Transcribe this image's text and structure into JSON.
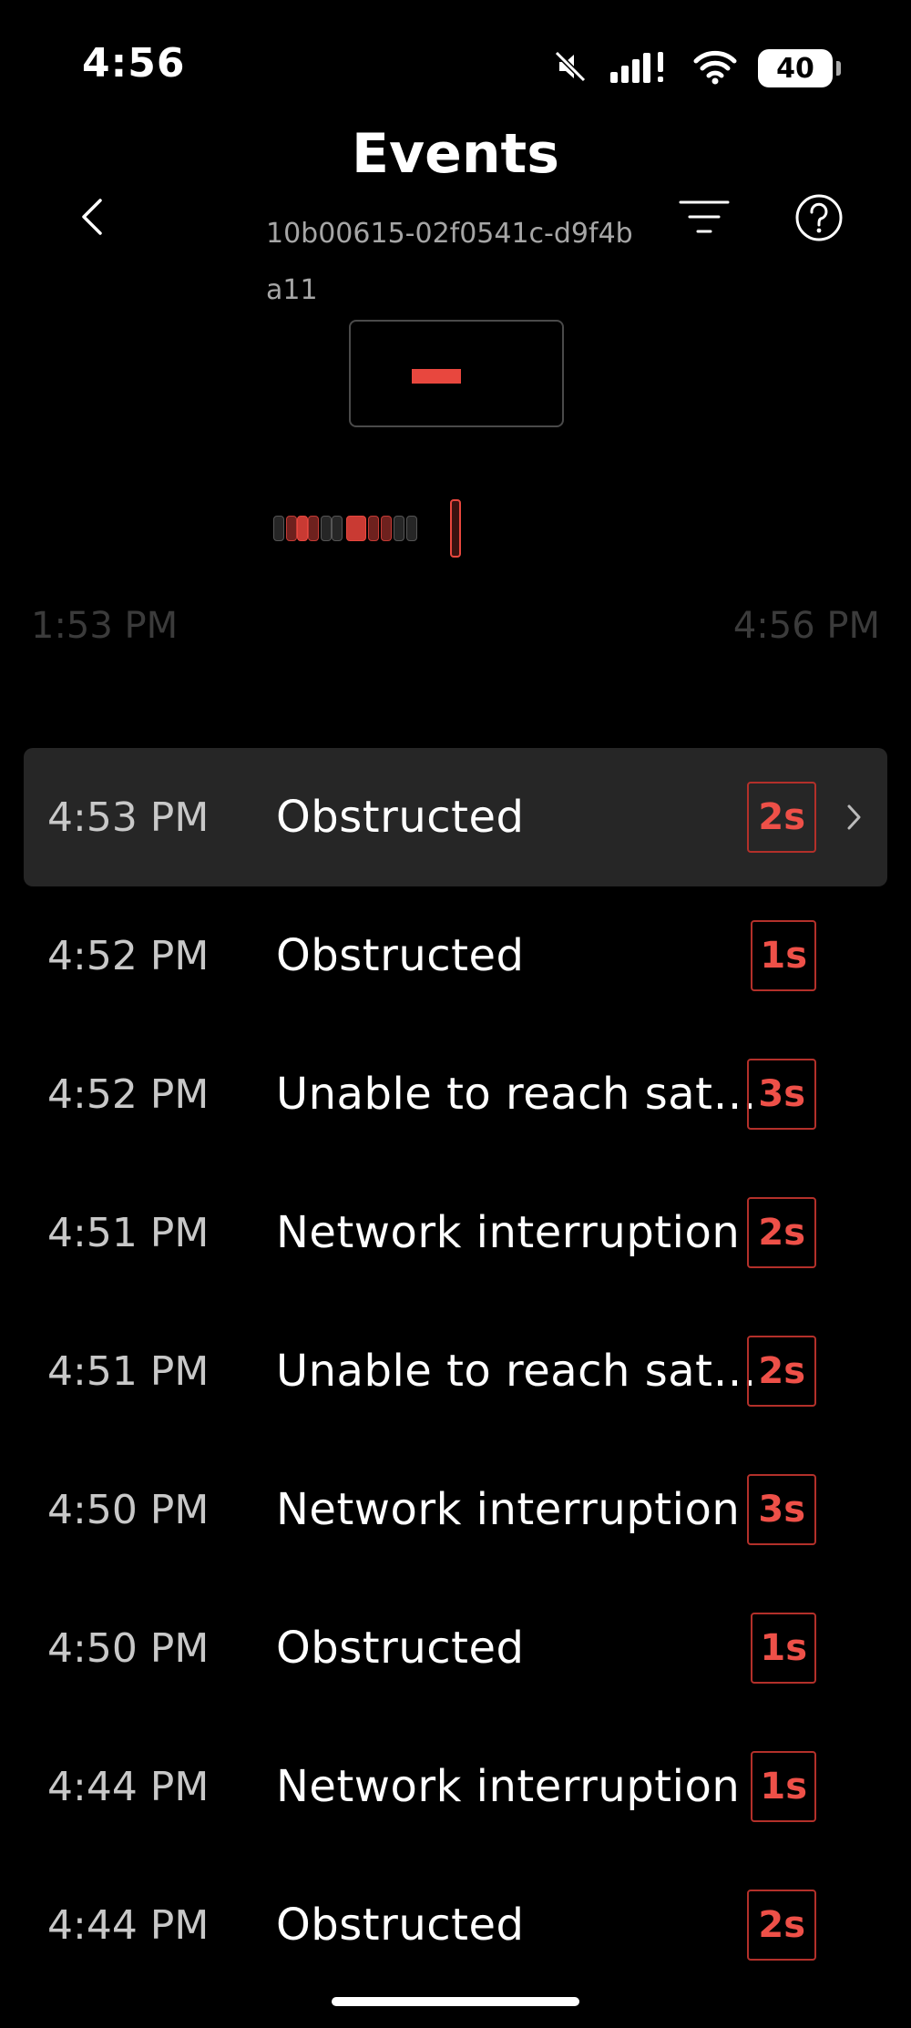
{
  "status_bar": {
    "time": "4:56",
    "battery": "40",
    "icons": [
      "mute-icon",
      "signal-icon",
      "wifi-icon",
      "battery-icon"
    ]
  },
  "header": {
    "title": "Events",
    "device_id": "10b00615-02f0541c-d9f4ba11",
    "icons": [
      "chevron-left-icon",
      "filter-icon",
      "help-icon"
    ]
  },
  "timeline": {
    "start_label": "1:53 PM",
    "end_label": "4:56 PM"
  },
  "events": [
    {
      "time": "4:53 PM",
      "label": "Obstructed",
      "duration": "2s",
      "selected": true
    },
    {
      "time": "4:52 PM",
      "label": "Obstructed",
      "duration": "1s",
      "selected": false
    },
    {
      "time": "4:52 PM",
      "label": "Unable to reach satell...",
      "duration": "3s",
      "selected": false
    },
    {
      "time": "4:51 PM",
      "label": "Network interruption",
      "duration": "2s",
      "selected": false
    },
    {
      "time": "4:51 PM",
      "label": "Unable to reach satell...",
      "duration": "2s",
      "selected": false
    },
    {
      "time": "4:50 PM",
      "label": "Network interruption",
      "duration": "3s",
      "selected": false
    },
    {
      "time": "4:50 PM",
      "label": "Obstructed",
      "duration": "1s",
      "selected": false
    },
    {
      "time": "4:44 PM",
      "label": "Network interruption",
      "duration": "1s",
      "selected": false
    },
    {
      "time": "4:44 PM",
      "label": "Obstructed",
      "duration": "2s",
      "selected": false
    }
  ],
  "colors": {
    "background": "#000000",
    "accent_red": "#e8473e",
    "selected_row": "#262626",
    "muted_text": "#a6a6a6"
  }
}
